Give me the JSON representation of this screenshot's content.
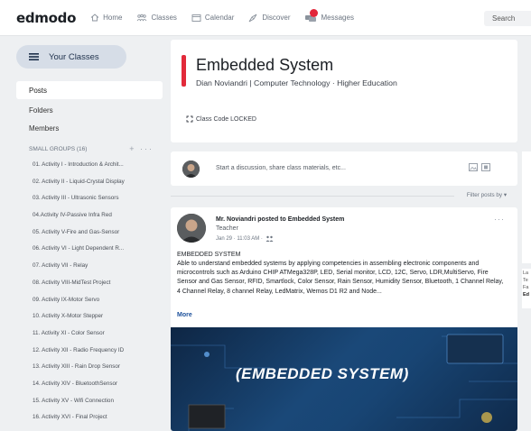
{
  "topbar": {
    "logo": "edmodo",
    "nav": [
      {
        "label": "Home",
        "icon": "home-icon"
      },
      {
        "label": "Classes",
        "icon": "classes-icon"
      },
      {
        "label": "Calendar",
        "icon": "calendar-icon"
      },
      {
        "label": "Discover",
        "icon": "discover-icon"
      },
      {
        "label": "Messages",
        "icon": "messages-icon"
      }
    ],
    "search_label": "Search"
  },
  "sidebar": {
    "your_classes": "Your Classes",
    "menu": [
      "Posts",
      "Folders",
      "Members"
    ],
    "small_groups_label": "SMALL GROUPS (16)",
    "groups": [
      "01. Activity I - Introduction & Archit...",
      "02. Activity II - Liquid-Crystal Display",
      "03. Activity III - Ultrasonic Sensors",
      "04.Activity IV-Passive Infra Red",
      "05. Activity V-Fire and Gas-Sensor",
      "06. Activity VI - Light Dependent R...",
      "07. Activity VII - Relay",
      "08. Activity VIII-MidTest Project",
      "09. Activity IX-Motor Servo",
      "10. Activity X-Motor Stepper",
      "11. Activity XI - Color Sensor",
      "12. Activity XII - Radio Frequency ID",
      "13. Activity XIII - Rain Drop Sensor",
      "14. Activity XIV - BluetoothSensor",
      "15. Activity XV - Wifi Connection",
      "16. Activity XVI - Final Project"
    ]
  },
  "class": {
    "title": "Embedded System",
    "subtitle": "Dian Noviandri | Computer Technology  · Higher Education",
    "code": "Class Code LOCKED"
  },
  "compose": {
    "placeholder": "Start a discussion, share class materials, etc..."
  },
  "filter_label": "Filter posts by ▾",
  "post": {
    "author_line": "Mr. Noviandri posted to Embedded System",
    "role": "Teacher",
    "date": "Jan 29 · 11:03 AM ·",
    "heading": "EMBEDDED SYSTEM",
    "body": "Able to understand embedded systems by applying competencies in assembling electronic components and microcontrols such as Arduino CHIP ATMega328P, LED, Serial monitor, LCD, 12C, Servo, LDR,MultiServo, Fire Sensor and Gas Sensor, RFID, Smartlock, Color Sensor, Rain Sensor, Humidity Sensor, Bluetooth, 1 Channel Relay, 4 Channel Relay, 8 channel Relay, LedMatrix, Wemos D1 R2 and Node...",
    "more": "More",
    "banner_text": "(EMBEDDED SYSTEM)"
  },
  "right_panel": {
    "lines": [
      "La",
      "Te",
      "Fa",
      "Ed"
    ]
  },
  "colors": {
    "accent_red": "#e22a3a",
    "badge_red": "#e2263a",
    "link_blue": "#1b4f9a",
    "your_classes_bg": "#d6dde7"
  }
}
